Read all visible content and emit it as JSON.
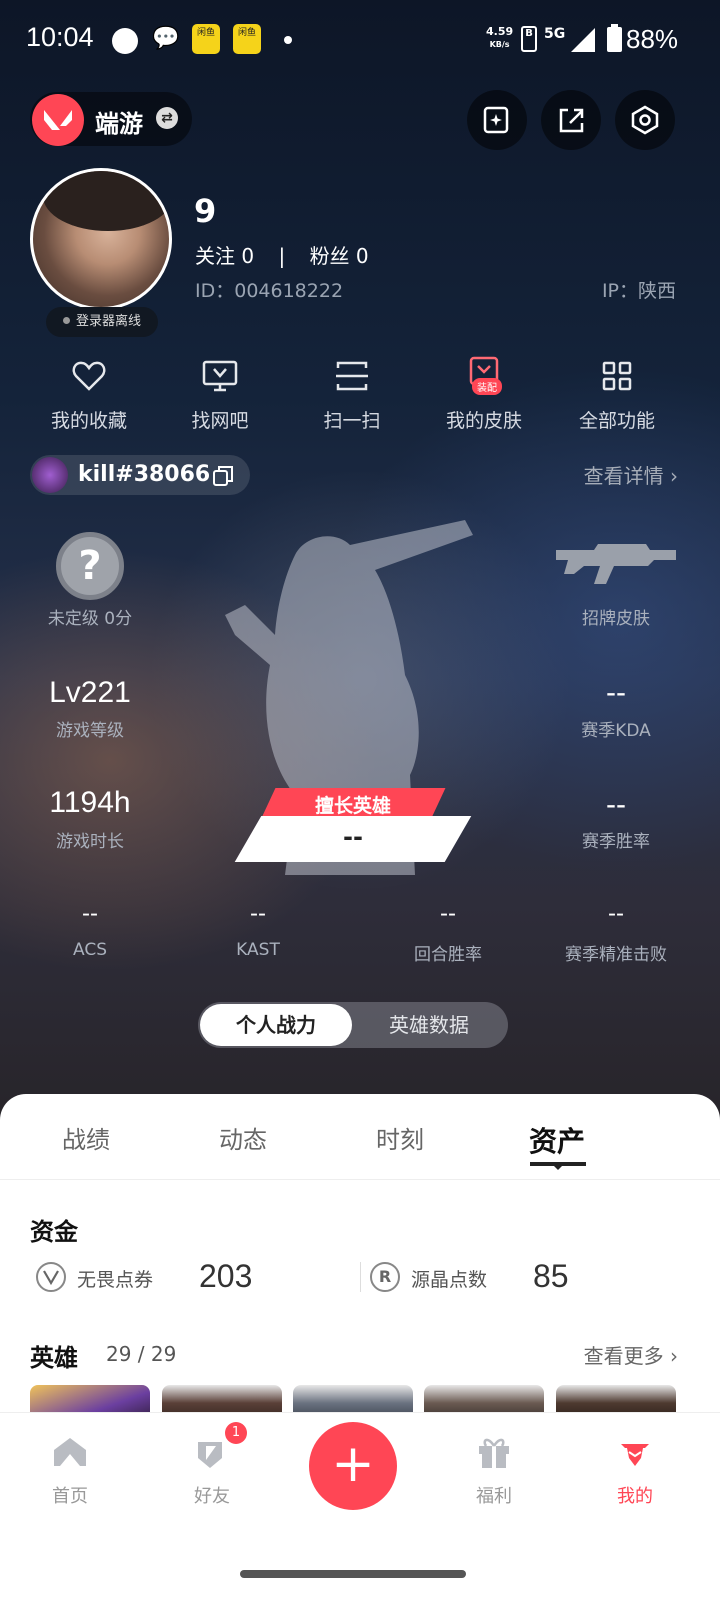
{
  "status_bar": {
    "time": "10:04",
    "net_speed_value": "4.59",
    "net_speed_unit": "KB/s",
    "network": "5G",
    "battery": "88%",
    "app_icon_text": "闲鱼"
  },
  "header": {
    "mode_label": "端游",
    "swap_icon": "⇄"
  },
  "profile": {
    "name": "9",
    "follow_label": "关注 0",
    "fans_label": "粉丝 0",
    "separator": "|",
    "id_text": "ID：004618222",
    "ip_text": "IP：陕西",
    "status": "登录器离线"
  },
  "quick_actions": {
    "favorites": "我的收藏",
    "netcafe": "找网吧",
    "scan": "扫一扫",
    "skins": "我的皮肤",
    "skins_badge": "装配",
    "all": "全部功能"
  },
  "player": {
    "tag": "kill#38066",
    "detail_link": "查看详情 ›"
  },
  "stats": {
    "rank_label": "未定级 0分",
    "rank_symbol": "?",
    "skin_label": "招牌皮肤",
    "level_value": "Lv221",
    "level_label": "游戏等级",
    "kda_value": "--",
    "kda_label": "赛季KDA",
    "hours_value": "1194h",
    "hours_label": "游戏时长",
    "winrate_value": "--",
    "winrate_label": "赛季胜率",
    "best_hero_tag": "擅长英雄",
    "best_hero_value": "--",
    "acs_value": "--",
    "acs_label": "ACS",
    "kast_value": "--",
    "kast_label": "KAST",
    "round_value": "--",
    "round_label": "回合胜率",
    "hs_value": "--",
    "hs_label": "赛季精准击败"
  },
  "toggle": {
    "active": "个人战力",
    "inactive": "英雄数据"
  },
  "tabs": [
    "战绩",
    "动态",
    "时刻",
    "资产"
  ],
  "assets": {
    "funds_title": "资金",
    "vp_label": "无畏点券",
    "vp_value": "203",
    "rp_label": "源晶点数",
    "rp_value": "85",
    "rp_symbol": "R",
    "heroes_title": "英雄",
    "heroes_count": "29 / 29",
    "more_link": "查看更多 ›"
  },
  "nav": {
    "home": "首页",
    "friends": "好友",
    "friends_badge": "1",
    "add": "+",
    "welfare": "福利",
    "mine": "我的"
  },
  "colors": {
    "accent": "#ff4655",
    "background": "#0f1a2b"
  }
}
